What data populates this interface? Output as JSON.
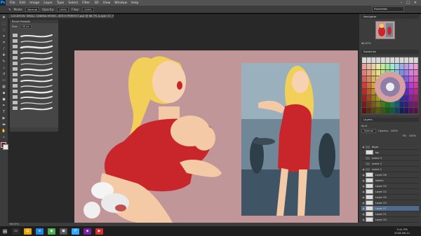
{
  "app": {
    "logo": "Ps"
  },
  "menu": [
    "File",
    "Edit",
    "Image",
    "Layer",
    "Type",
    "Select",
    "Filter",
    "3D",
    "View",
    "Window",
    "Help"
  ],
  "window_controls": [
    "–",
    "□",
    "✕"
  ],
  "options_bar": {
    "mode_label": "Mode:",
    "mode_value": "Normal",
    "opacity_label": "Opacity:",
    "opacity_value": "100%",
    "flow_label": "Flow:",
    "flow_value": "100%",
    "workspace": "Essentials"
  },
  "document_tab": "LOCATION: SMALL CINEMA MOVIE...BITCH PERFECT.psd @ 66.7% (Layer 27, RGB/8) *",
  "brush_presets": {
    "title": "Brush Presets",
    "size_label": "Size:",
    "size_value": "40 px"
  },
  "navigator": {
    "title": "Navigator",
    "zoom": "66.67%"
  },
  "swatches": {
    "title": "Swatches"
  },
  "layers": {
    "title": "Layers",
    "kind_label": "Kind",
    "blend_mode": "Normal",
    "opacity_label": "Opacity:",
    "opacity_value": "100%",
    "fill_label": "Fill:",
    "fill_value": "100%",
    "rows": [
      {
        "name": "bkgd",
        "type": "group",
        "visible": true
      },
      {
        "name": "bg",
        "type": "layer",
        "visible": false
      },
      {
        "name": "scene 3",
        "type": "group",
        "visible": false
      },
      {
        "name": "scene 2",
        "type": "group",
        "visible": false
      },
      {
        "name": "scene 1",
        "type": "group",
        "visible": true
      },
      {
        "name": "Layer 26",
        "type": "layer",
        "visible": true
      },
      {
        "name": "sketch",
        "type": "layer",
        "visible": true
      },
      {
        "name": "Layer 25",
        "type": "layer",
        "visible": true
      },
      {
        "name": "Layer 22",
        "type": "layer",
        "visible": true
      },
      {
        "name": "Layer 24",
        "type": "layer",
        "visible": true
      },
      {
        "name": "Layer 23",
        "type": "layer",
        "visible": true
      },
      {
        "name": "Layer 27",
        "type": "layer",
        "visible": true,
        "selected": true
      },
      {
        "name": "Layer 21",
        "type": "layer",
        "visible": true
      },
      {
        "name": "Layer 20",
        "type": "layer",
        "visible": true
      }
    ]
  },
  "status": {
    "zoom": "66.67%"
  },
  "taskbar": {
    "time": "3:41 PM",
    "date": "2018-06-12"
  },
  "colors": {
    "canvas_bg": "#c09698",
    "dress": "#c8262b",
    "hair": "#f2cf58",
    "skin": "#f4caa6"
  }
}
